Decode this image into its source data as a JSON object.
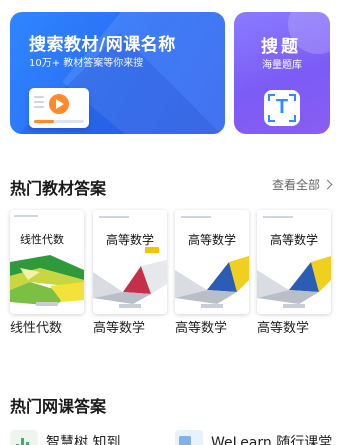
{
  "search_banner": {
    "title": "搜索教材/网课名称",
    "subtitle": "10万+ 教材答案等你来搜",
    "icon": "video-play-icon",
    "color": "#2f6ff0"
  },
  "question_banner": {
    "title": "搜题",
    "subtitle": "海量题库",
    "icon": "scan-t-icon",
    "color": "#7b5cf6"
  },
  "hot_textbooks": {
    "title": "热门教材答案",
    "view_all": "查看全部",
    "books": [
      {
        "name": "线性代数",
        "cover_title": "线性代数"
      },
      {
        "name": "高等数学",
        "cover_title": "高等数学"
      },
      {
        "name": "高等数学",
        "cover_title": "高等数学"
      },
      {
        "name": "高等数学",
        "cover_title": "高等数学"
      }
    ]
  },
  "hot_courses": {
    "title": "热门网课答案",
    "items": [
      {
        "name": "智慧树 知到"
      },
      {
        "name": "WeLearn 随行课堂"
      }
    ]
  }
}
